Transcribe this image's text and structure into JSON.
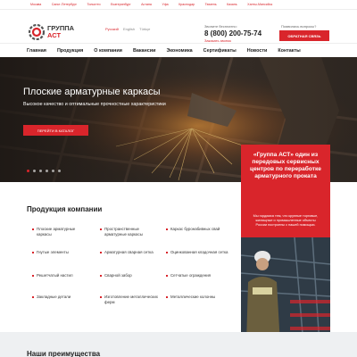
{
  "cities": [
    "Москва",
    "Санкт-Петербург",
    "Тольятти",
    "Екатеринбург",
    "Астана",
    "Уфа",
    "Краснодар",
    "Тюмень",
    "Казань",
    "Ханты-Мансийск"
  ],
  "header": {
    "logo_line1": "ГРУППА",
    "logo_line2": "АСТ",
    "languages": [
      "Русский",
      "English",
      "Türkçe"
    ],
    "call_label": "Звоните бесплатно:",
    "phone": "8 (800) 200-75-74",
    "callback_label": "Заказать звонок",
    "questions_label": "Появились вопросы?",
    "feedback_button": "ОБРАТНАЯ СВЯЗЬ"
  },
  "nav": [
    "Главная",
    "Продукция",
    "О компании",
    "Вакансии",
    "Экономика",
    "Сертификаты",
    "Новости",
    "Контакты"
  ],
  "hero": {
    "title": "Плоские арматурные каркасы",
    "subtitle": "Высокое качество и оптимальные прочностные характеристики",
    "button": "ПЕРЕЙТИ В КАТАЛОГ",
    "slides_total": 6,
    "slide_active": 1
  },
  "products": {
    "title": "Продукция компании",
    "items": [
      "Плоские арматурные каркасы",
      "Пространственные арматурные каркасы",
      "Каркас буронабивных свай",
      "Гнутые элементы",
      "Арматурная сварная сетка",
      "Оцинкованная кладочная сетка",
      "Решетчатый настил",
      "Сварной забор",
      "Сетчатые ограждения",
      "Закладные детали",
      "Изготовление металлических ферм",
      "Металлические колонны"
    ]
  },
  "promo": {
    "title": "«Группа АСТ» один из передовых сервисных центров по переработке арматурного проката",
    "text": "Мы гордимся тем, что крупные торговые, жилищные и промышленные объекты России построены с нашей помощью."
  },
  "advantages_title": "Наши преимущества",
  "colors": {
    "accent": "#d9252b"
  }
}
